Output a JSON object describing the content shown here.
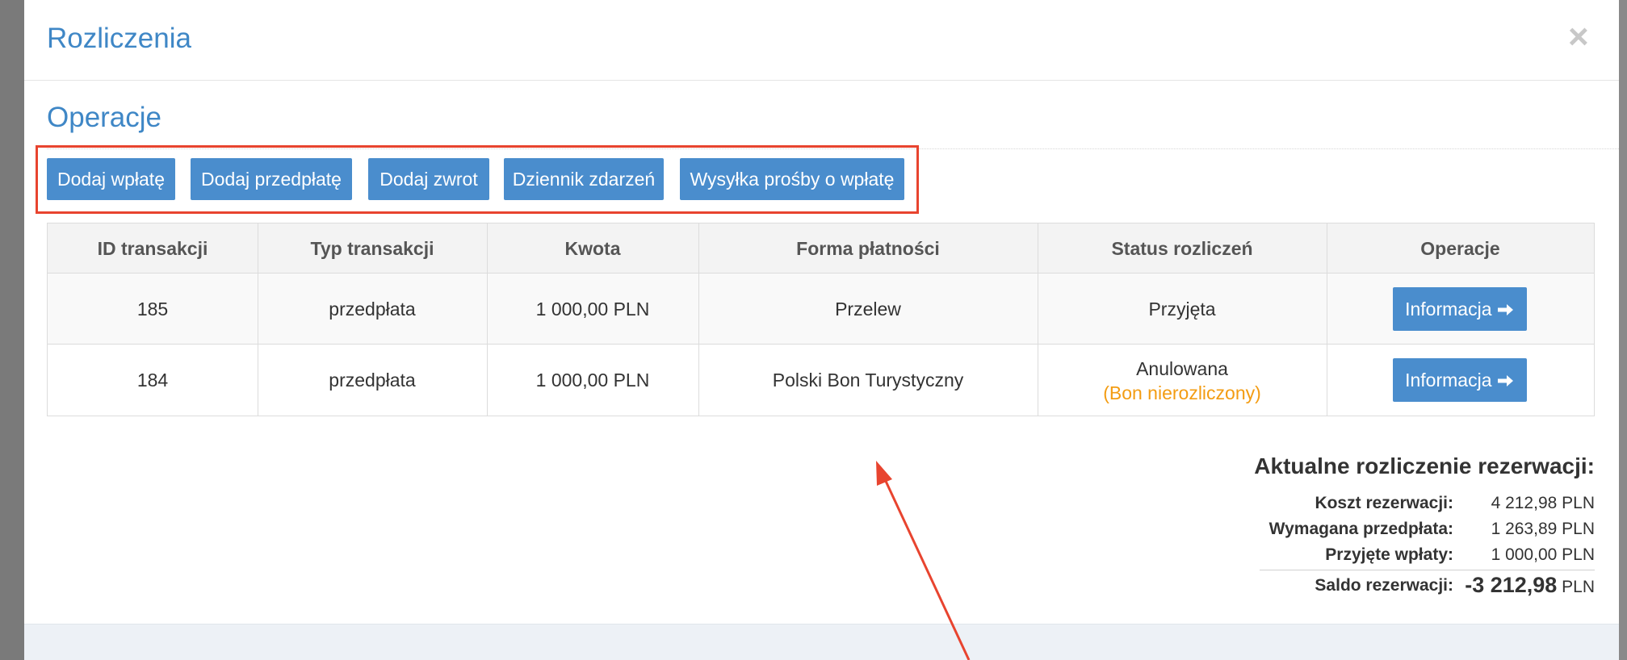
{
  "modal": {
    "title": "Rozliczenia",
    "close_symbol": "×"
  },
  "section": {
    "title": "Operacje"
  },
  "toolbar": {
    "buttons": [
      {
        "label": "Dodaj wpłatę"
      },
      {
        "label": "Dodaj przedpłatę"
      },
      {
        "label": "Dodaj zwrot"
      },
      {
        "label": "Dziennik zdarzeń"
      },
      {
        "label": "Wysyłka prośby o wpłatę"
      }
    ]
  },
  "table": {
    "headers": [
      "ID transakcji",
      "Typ transakcji",
      "Kwota",
      "Forma płatności",
      "Status rozliczeń",
      "Operacje"
    ],
    "rows": [
      {
        "id": "185",
        "type": "przedpłata",
        "amount": "1 000,00 PLN",
        "method": "Przelew",
        "status": "Przyjęta",
        "status_note": "",
        "action": "Informacja"
      },
      {
        "id": "184",
        "type": "przedpłata",
        "amount": "1 000,00 PLN",
        "method": "Polski Bon Turystyczny",
        "status": "Anulowana",
        "status_note": "(Bon nierozliczony)",
        "action": "Informacja"
      }
    ]
  },
  "summary": {
    "title": "Aktualne rozliczenie rezerwacji:",
    "items": [
      {
        "label": "Koszt rezerwacji:",
        "value": "4 212,98 PLN"
      },
      {
        "label": "Wymagana przedpłata:",
        "value": "1 263,89 PLN"
      },
      {
        "label": "Przyjęte wpłaty:",
        "value": "1 000,00 PLN"
      }
    ],
    "balance_label": "Saldo rezerwacji:",
    "balance_value": "-3 212,98",
    "balance_currency": "PLN"
  },
  "colors": {
    "accent": "#4a8dcd",
    "title_blue": "#3f87c6",
    "highlight_red": "#e8442f",
    "note_orange": "#f39c12"
  },
  "icons": {
    "close": "close-icon",
    "action_arrow": "arrow-right-icon",
    "annotation": "annotation-arrow"
  }
}
